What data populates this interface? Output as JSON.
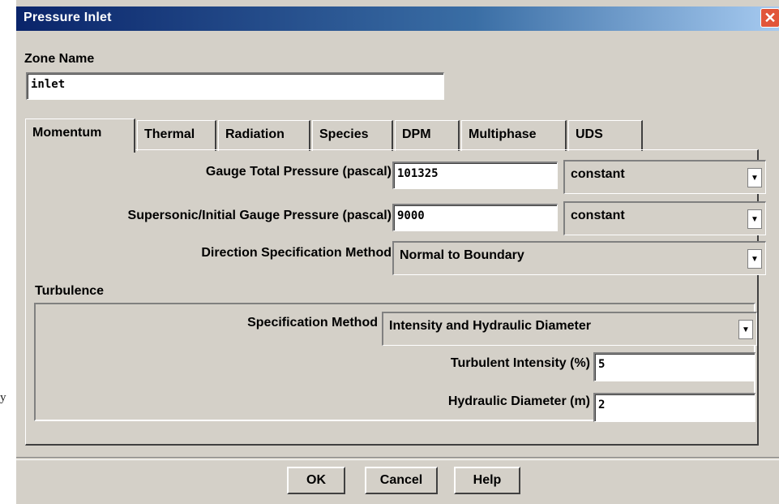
{
  "window": {
    "title": "Pressure Inlet",
    "close_glyph": "✕"
  },
  "stray_char": "y",
  "zone": {
    "label": "Zone Name",
    "value": "inlet"
  },
  "tabs": [
    {
      "label": "Momentum",
      "active": true
    },
    {
      "label": "Thermal"
    },
    {
      "label": "Radiation"
    },
    {
      "label": "Species"
    },
    {
      "label": "DPM"
    },
    {
      "label": "Multiphase"
    },
    {
      "label": "UDS"
    }
  ],
  "momentum": {
    "gauge_total_pressure": {
      "label": "Gauge Total Pressure (pascal)",
      "value": "101325",
      "profile": "constant"
    },
    "supersonic_pressure": {
      "label": "Supersonic/Initial Gauge Pressure (pascal)",
      "value": "9000",
      "profile": "constant"
    },
    "direction_method": {
      "label": "Direction Specification Method",
      "value": "Normal to Boundary"
    }
  },
  "turbulence": {
    "label": "Turbulence",
    "spec_method": {
      "label": "Specification Method",
      "value": "Intensity and Hydraulic Diameter"
    },
    "intensity": {
      "label": "Turbulent Intensity (%)",
      "value": "5"
    },
    "diameter": {
      "label": "Hydraulic Diameter (m)",
      "value": "2"
    }
  },
  "buttons": {
    "ok": "OK",
    "cancel": "Cancel",
    "help": "Help"
  },
  "icons": {
    "dropdown": "chevron-down-icon",
    "close": "close-icon"
  }
}
